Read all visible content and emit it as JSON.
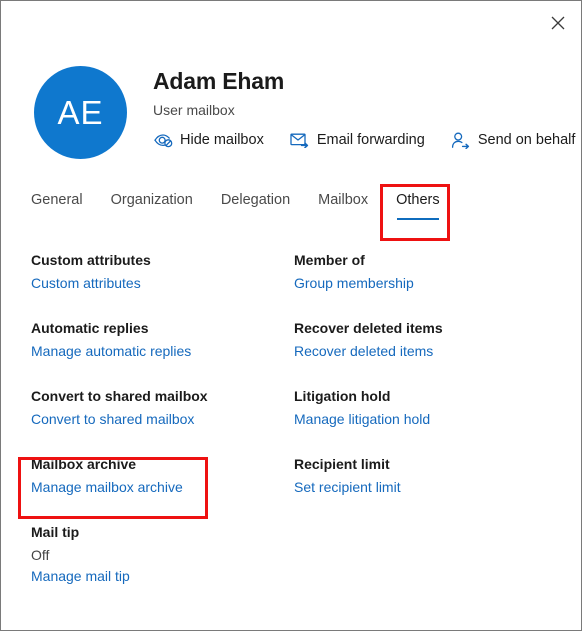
{
  "window": {
    "close_label": "Close",
    "close_icon": "close-icon",
    "border_color": "#7a7a7a"
  },
  "header": {
    "avatar_initials": "AE",
    "avatar_color": "#0f78ce",
    "name": "Adam Eham",
    "subtitle": "User mailbox",
    "actions": [
      {
        "label": "Hide mailbox",
        "icon": "eye-hidden-icon"
      },
      {
        "label": "Email forwarding",
        "icon": "envelope-forward-icon"
      },
      {
        "label": "Send on behalf",
        "icon": "person-arrow-icon"
      }
    ]
  },
  "tabs": {
    "accent_color": "#0f6cbd",
    "items": [
      {
        "label": "General",
        "active": false
      },
      {
        "label": "Organization",
        "active": false
      },
      {
        "label": "Delegation",
        "active": false
      },
      {
        "label": "Mailbox",
        "active": false
      },
      {
        "label": "Others",
        "active": true
      }
    ]
  },
  "annotations": {
    "color": "#ee1111",
    "items": [
      {
        "name": "others-tab-highlight"
      },
      {
        "name": "mailbox-archive-highlight"
      }
    ]
  },
  "settings": {
    "link_color": "#1569bd",
    "items": [
      {
        "title": "Custom attributes",
        "status": null,
        "link": "Custom attributes"
      },
      {
        "title": "Member of",
        "status": null,
        "link": "Group membership"
      },
      {
        "title": "Automatic replies",
        "status": null,
        "link": "Manage automatic replies"
      },
      {
        "title": "Recover deleted items",
        "status": null,
        "link": "Recover deleted items"
      },
      {
        "title": "Convert to shared mailbox",
        "status": null,
        "link": "Convert to shared mailbox"
      },
      {
        "title": "Litigation hold",
        "status": null,
        "link": "Manage litigation hold"
      },
      {
        "title": "Mailbox archive",
        "status": null,
        "link": "Manage mailbox archive"
      },
      {
        "title": "Recipient limit",
        "status": null,
        "link": "Set recipient limit"
      },
      {
        "title": "Mail tip",
        "status": "Off",
        "link": "Manage mail tip"
      }
    ]
  }
}
